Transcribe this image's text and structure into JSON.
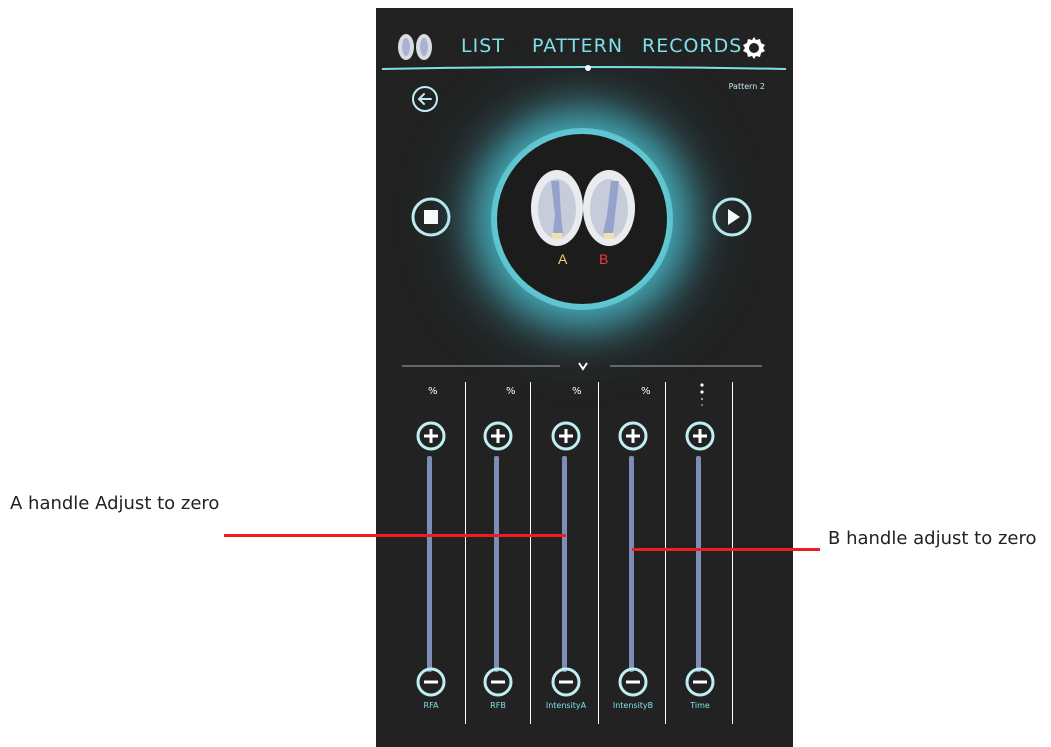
{
  "nav": {
    "items": [
      "LIST",
      "PATTERN",
      "RECORDS"
    ],
    "active": "PATTERN"
  },
  "pattern_label": "Pattern 2",
  "handles": {
    "a_label": "A",
    "b_label": "B"
  },
  "sliders": [
    {
      "unit": "%",
      "label": "RFA"
    },
    {
      "unit": "%",
      "label": "RFB"
    },
    {
      "unit": "%",
      "label": "IntensityA"
    },
    {
      "unit": "%",
      "label": "IntensityB"
    },
    {
      "unit": "",
      "label": "Time"
    }
  ],
  "annotations": {
    "a_note": "A   handle   Adjust to zero",
    "b_note": "B handle adjust to zero"
  },
  "colors": {
    "background": "#222222",
    "accent": "#7fe0ea",
    "label_a": "#f2d25c",
    "label_b": "#f23a3a",
    "track": "#7d8db5",
    "annotation_line": "#ee1c24"
  }
}
